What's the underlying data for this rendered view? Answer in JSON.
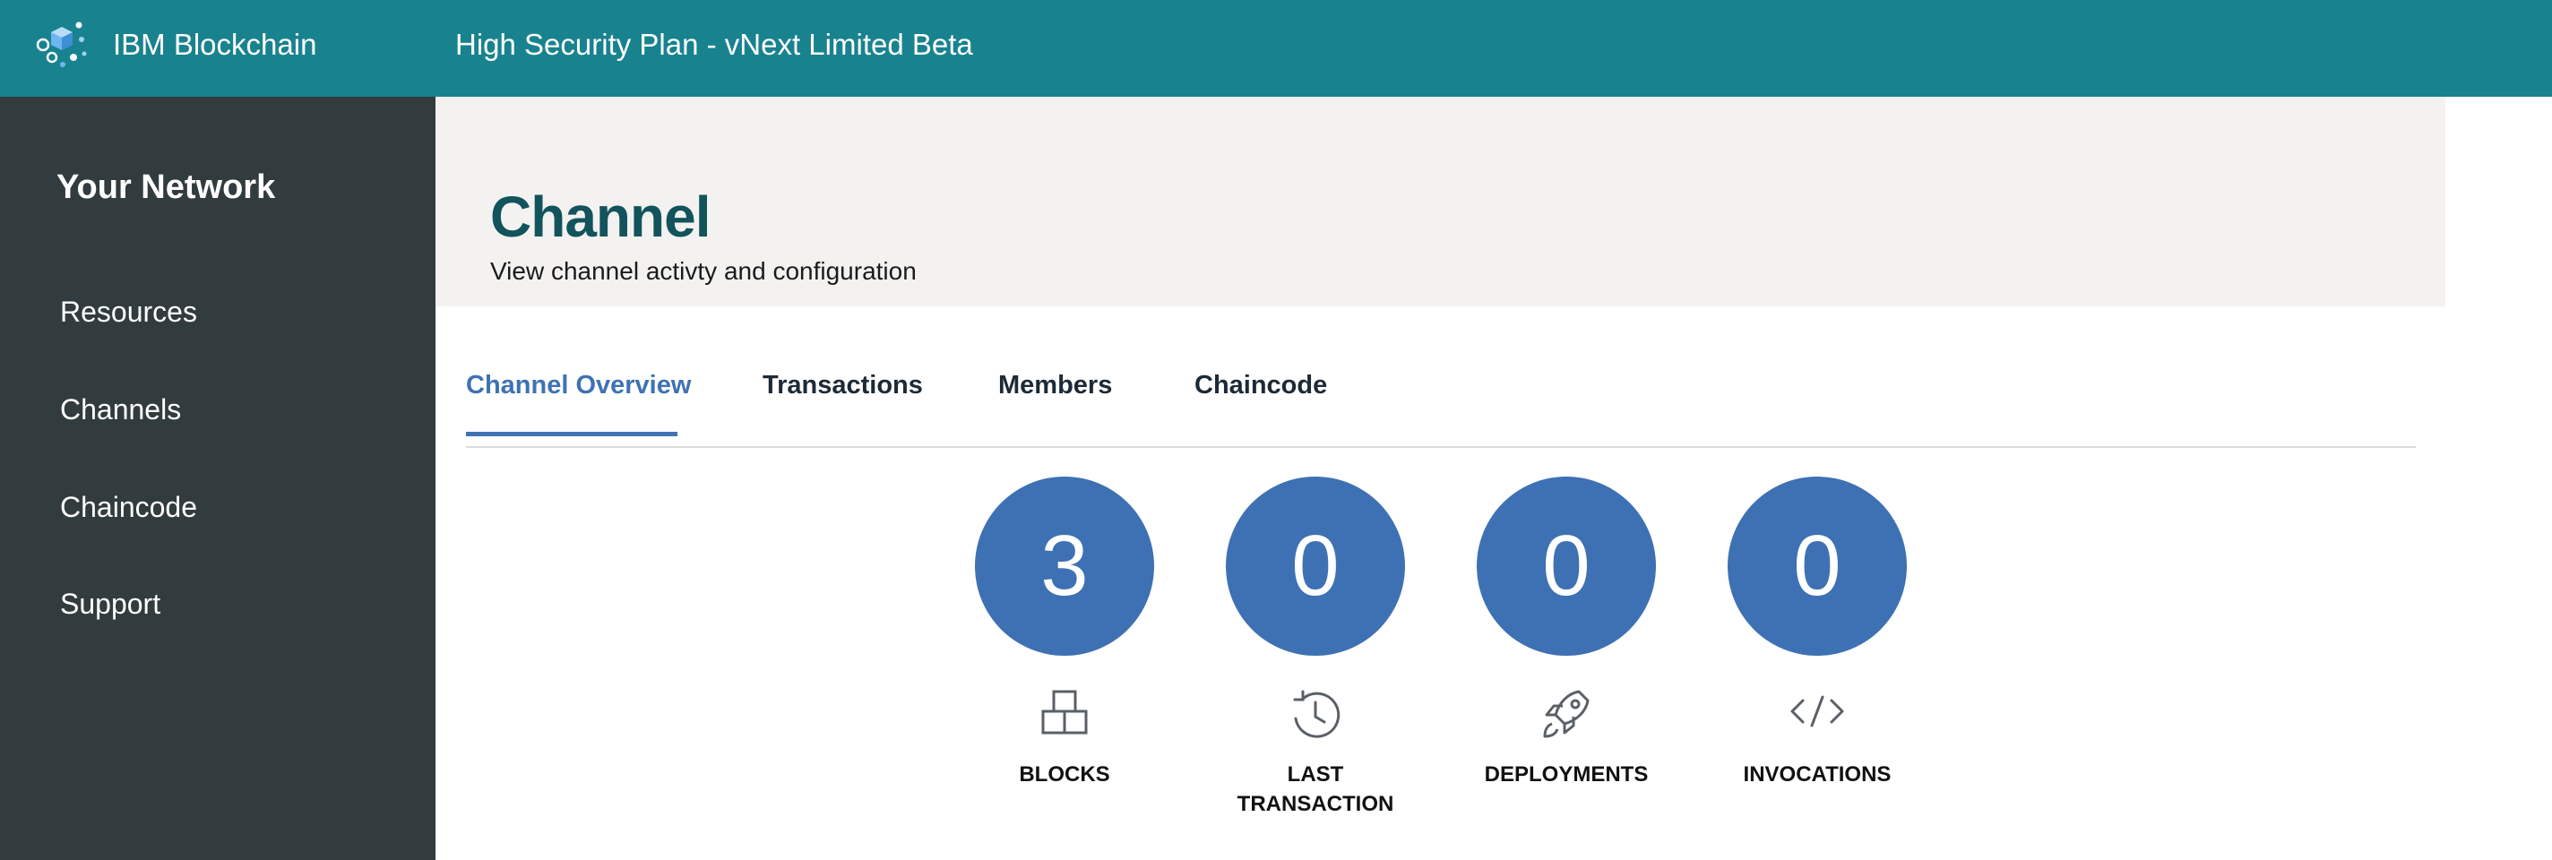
{
  "topbar": {
    "brand": "IBM Blockchain",
    "plan": "High Security Plan - vNext Limited Beta",
    "logo_icon": "blockchain-cubes-icon"
  },
  "sidebar": {
    "title": "Your Network",
    "items": [
      {
        "label": "Resources"
      },
      {
        "label": "Channels"
      },
      {
        "label": "Chaincode"
      },
      {
        "label": "Support"
      }
    ]
  },
  "header": {
    "title": "Channel",
    "subtitle": "View channel activty and configuration"
  },
  "tabs": [
    {
      "label": "Channel Overview",
      "active": true
    },
    {
      "label": "Transactions",
      "active": false
    },
    {
      "label": "Members",
      "active": false
    },
    {
      "label": "Chaincode",
      "active": false
    }
  ],
  "stats": [
    {
      "value": "3",
      "label": "BLOCKS",
      "icon": "blocks-icon"
    },
    {
      "value": "0",
      "label": "LAST\nTRANSACTION",
      "icon": "clock-icon"
    },
    {
      "value": "0",
      "label": "DEPLOYMENTS",
      "icon": "rocket-icon"
    },
    {
      "value": "0",
      "label": "INVOCATIONS",
      "icon": "code-icon"
    }
  ],
  "colors": {
    "topbar": "#19828f",
    "sidebar": "#323b3d",
    "header_panel": "#f3f2f1",
    "title": "#12535c",
    "accent": "#3f72b4",
    "stat_circle": "#3e71b3"
  }
}
